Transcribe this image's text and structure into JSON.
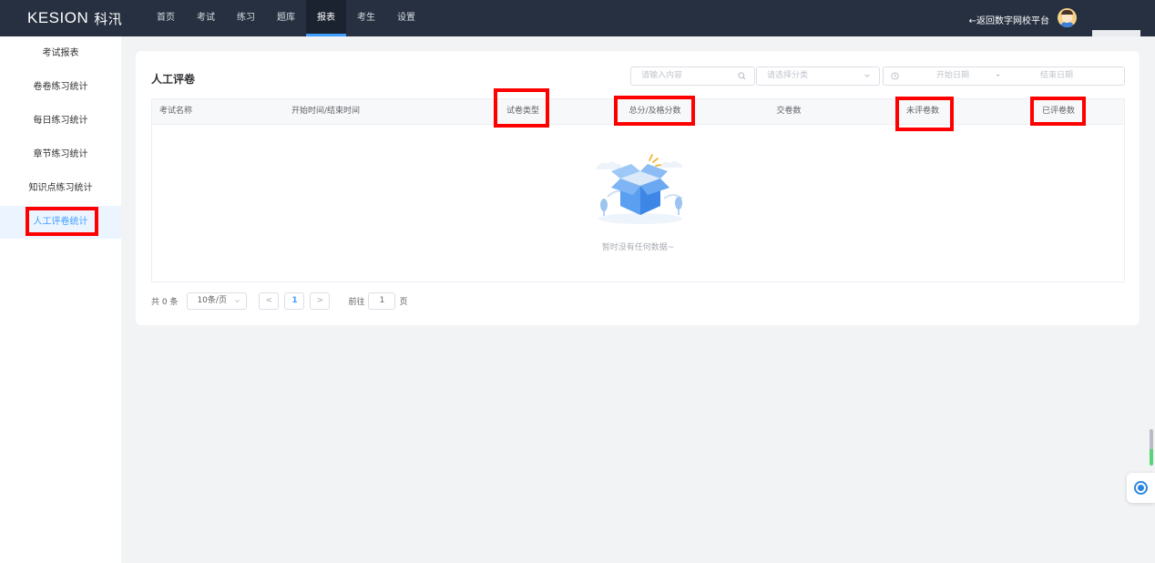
{
  "header": {
    "logo_text": "KESION",
    "logo_cn": "科汛",
    "nav": [
      {
        "label": "首页",
        "active": false
      },
      {
        "label": "考试",
        "active": false
      },
      {
        "label": "练习",
        "active": false
      },
      {
        "label": "题库",
        "active": false
      },
      {
        "label": "报表",
        "active": true
      },
      {
        "label": "考生",
        "active": false
      },
      {
        "label": "设置",
        "active": false
      }
    ],
    "back_link": "←返回数字网校平台",
    "accent": "#409eff"
  },
  "sidebar": {
    "items": [
      {
        "label": "考试报表",
        "active": false
      },
      {
        "label": "卷卷练习统计",
        "active": false
      },
      {
        "label": "每日练习统计",
        "active": false
      },
      {
        "label": "章节练习统计",
        "active": false
      },
      {
        "label": "知识点练习统计",
        "active": false
      },
      {
        "label": "人工评卷统计",
        "active": true
      }
    ]
  },
  "main": {
    "title": "人工评卷",
    "search_placeholder": "请输入内容",
    "category_placeholder": "请选择分类",
    "start_date_placeholder": "开始日期",
    "range_separator": "-",
    "end_date_placeholder": "结束日期",
    "table": {
      "columns": [
        "考试名称",
        "开始时间/结束时间",
        "试卷类型",
        "总分/及格分数",
        "交卷数",
        "未评卷数",
        "已评卷数"
      ],
      "rows": [],
      "empty_text": "暂时没有任何数据~"
    },
    "pagination": {
      "total": "共 0 条",
      "page_size": "10条/页",
      "prev": "<",
      "current_page": "1",
      "next": ">",
      "goto_label": "前往",
      "goto_value": "1",
      "page_unit": "页"
    }
  },
  "icons": [
    "search-icon",
    "chevron-down-icon",
    "clock-icon",
    "chevron-left-icon",
    "chevron-right-icon",
    "empty-box-illustration",
    "support-icon"
  ],
  "highlight_color": "#ff0000"
}
